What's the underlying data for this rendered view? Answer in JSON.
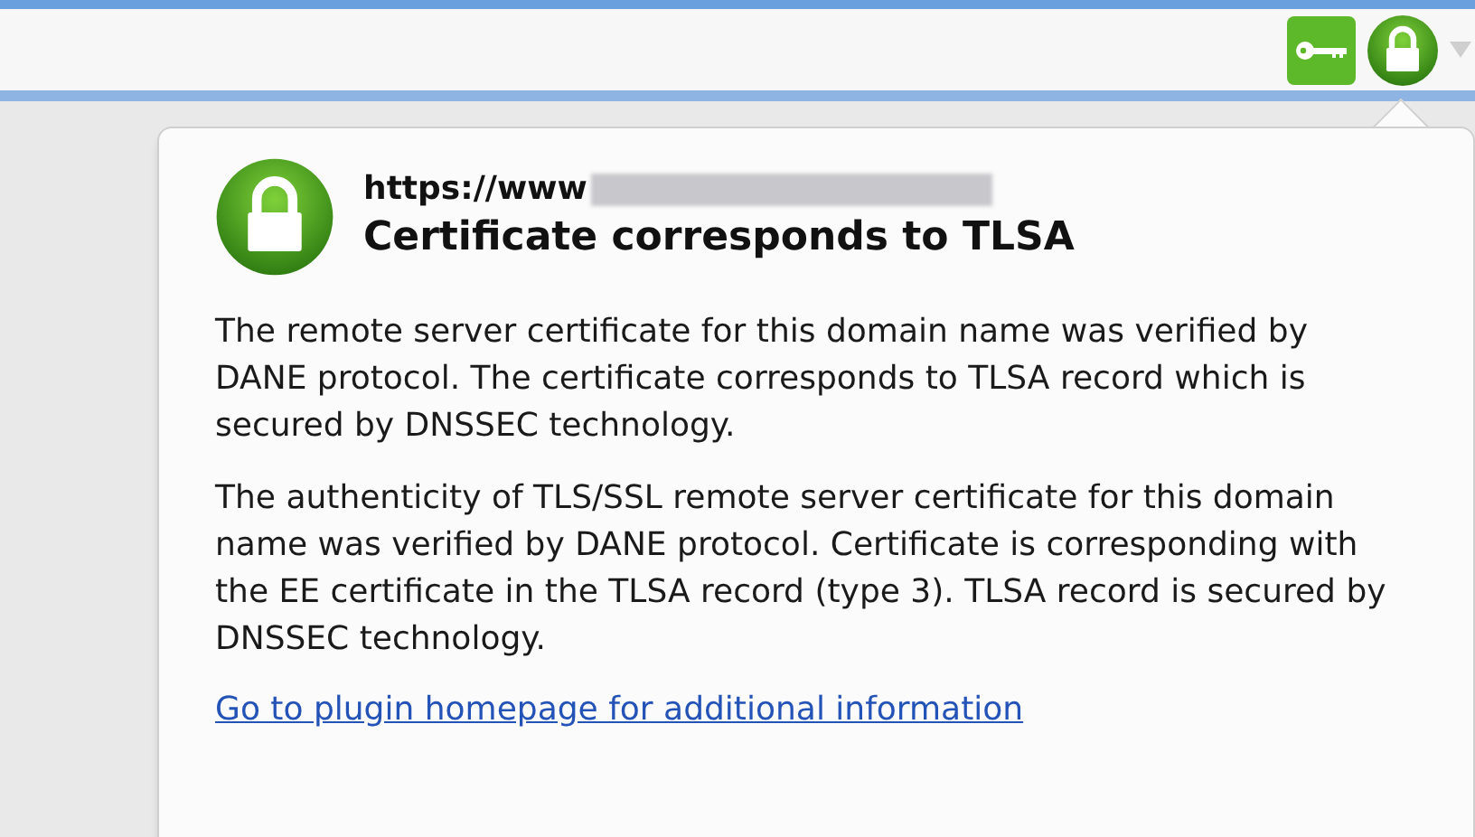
{
  "popup": {
    "url": "https://www",
    "title": "Certificate corresponds to TLSA",
    "paragraphs": [
      "The remote server certificate for this domain name was verified by DANE protocol. The certificate corresponds to TLSA record which is secured by DNSSEC technology.",
      "The authenticity of TLS/SSL remote server certificate for this domain name was verified by DANE protocol. Certificate is corresponding with the EE certificate in the TLSA record (type 3). TLSA record is secured by DNSSEC technology."
    ],
    "link": "Go to plugin homepage for additional information"
  }
}
